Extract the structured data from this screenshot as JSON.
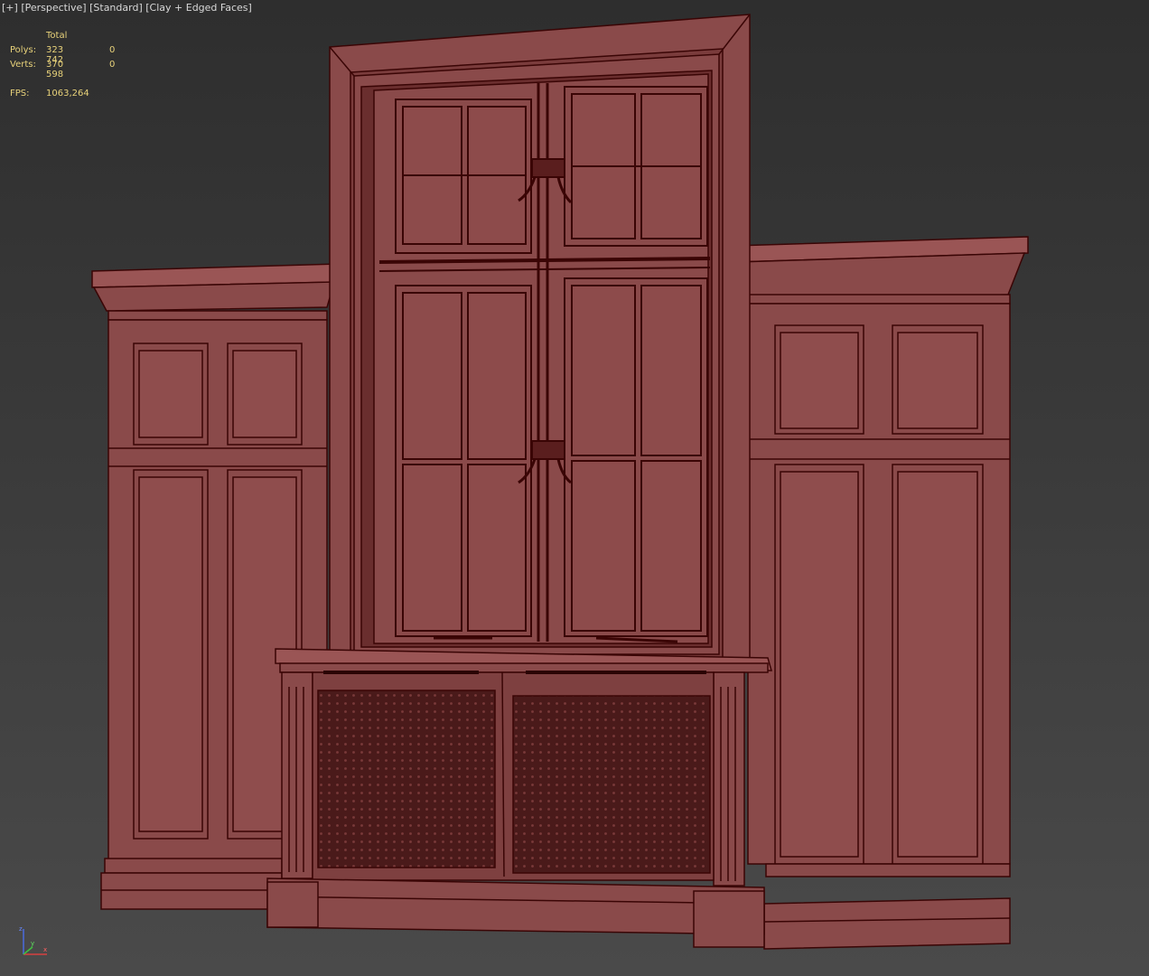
{
  "viewport": {
    "labels": [
      "[+]",
      "[Perspective]",
      "[Standard]",
      "[Clay + Edged Faces]"
    ]
  },
  "stats": {
    "header": "Total",
    "polys_label": "Polys:",
    "polys_value": "323 742",
    "polys_selected": "0",
    "verts_label": "Verts:",
    "verts_value": "370 598",
    "verts_selected": "0",
    "fps_label": "FPS:",
    "fps_value": "1063,264"
  },
  "colors": {
    "clay": "#8a4a4a",
    "edge": "#3a0505",
    "stats_text": "#e8d27a",
    "label_text": "#d8d8d8",
    "background_top": "#2e2e2e",
    "background_bottom": "#4a4a4a"
  },
  "axis_gizmo": {
    "icon": "xyz-axis-tripod-icon"
  }
}
